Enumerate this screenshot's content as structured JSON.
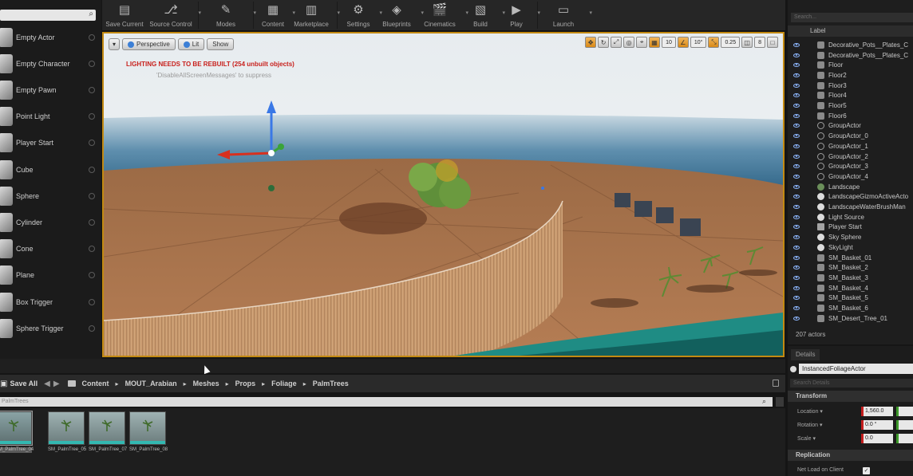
{
  "toolbar": {
    "buttons": [
      {
        "label": "Save Current",
        "icon": "save-icon"
      },
      {
        "label": "Source Control",
        "icon": "source-control-icon"
      },
      {
        "label": "Modes",
        "icon": "modes-icon"
      },
      {
        "label": "Content",
        "icon": "content-icon"
      },
      {
        "label": "Marketplace",
        "icon": "marketplace-icon"
      },
      {
        "label": "Settings",
        "icon": "settings-icon"
      },
      {
        "label": "Blueprints",
        "icon": "blueprints-icon"
      },
      {
        "label": "Cinematics",
        "icon": "cinematics-icon"
      },
      {
        "label": "Build",
        "icon": "build-icon"
      },
      {
        "label": "Play",
        "icon": "play-icon"
      },
      {
        "label": "Launch",
        "icon": "launch-icon"
      }
    ]
  },
  "place_panel": {
    "items": [
      {
        "label": "Empty Actor"
      },
      {
        "label": "Empty Character"
      },
      {
        "label": "Empty Pawn"
      },
      {
        "label": "Point Light"
      },
      {
        "label": "Player Start"
      },
      {
        "label": "Cube"
      },
      {
        "label": "Sphere"
      },
      {
        "label": "Cylinder"
      },
      {
        "label": "Cone"
      },
      {
        "label": "Plane"
      },
      {
        "label": "Box Trigger"
      },
      {
        "label": "Sphere Trigger"
      }
    ]
  },
  "viewport": {
    "perspective_label": "Perspective",
    "lit_label": "Lit",
    "show_label": "Show",
    "warning": "LIGHTING NEEDS TO BE REBUILT (254 unbuilt objects)",
    "suppress_hint": "'DisableAllScreenMessages' to suppress",
    "grid_snap": "10",
    "rotation_snap": "10°",
    "scale_snap": "0.25",
    "camera_speed": "8"
  },
  "outliner": {
    "search_placeholder": "Search...",
    "column_label": "Label",
    "rows": [
      {
        "label": "Decorative_Pots__Plates_C",
        "kind": "mesh"
      },
      {
        "label": "Decorative_Pots__Plates_C",
        "kind": "mesh"
      },
      {
        "label": "Floor",
        "kind": "mesh"
      },
      {
        "label": "Floor2",
        "kind": "mesh"
      },
      {
        "label": "Floor3",
        "kind": "mesh"
      },
      {
        "label": "Floor4",
        "kind": "mesh"
      },
      {
        "label": "Floor5",
        "kind": "mesh"
      },
      {
        "label": "Floor6",
        "kind": "mesh"
      },
      {
        "label": "GroupActor",
        "kind": "group"
      },
      {
        "label": "GroupActor_0",
        "kind": "group"
      },
      {
        "label": "GroupActor_1",
        "kind": "group"
      },
      {
        "label": "GroupActor_2",
        "kind": "group"
      },
      {
        "label": "GroupActor_3",
        "kind": "group"
      },
      {
        "label": "GroupActor_4",
        "kind": "group"
      },
      {
        "label": "Landscape",
        "kind": "land"
      },
      {
        "label": "LandscapeGizmoActiveActo",
        "kind": "light"
      },
      {
        "label": "LandscapeWaterBrushMan",
        "kind": "light"
      },
      {
        "label": "Light Source",
        "kind": "light"
      },
      {
        "label": "Player Start",
        "kind": "player"
      },
      {
        "label": "Sky Sphere",
        "kind": "light"
      },
      {
        "label": "SkyLight",
        "kind": "light"
      },
      {
        "label": "SM_Basket_01",
        "kind": "mesh"
      },
      {
        "label": "SM_Basket_2",
        "kind": "mesh"
      },
      {
        "label": "SM_Basket_3",
        "kind": "mesh"
      },
      {
        "label": "SM_Basket_4",
        "kind": "mesh"
      },
      {
        "label": "SM_Basket_5",
        "kind": "mesh"
      },
      {
        "label": "SM_Basket_6",
        "kind": "mesh"
      },
      {
        "label": "SM_Desert_Tree_01",
        "kind": "mesh"
      }
    ],
    "actor_count": "207 actors"
  },
  "details": {
    "tab_label": "Details",
    "selected_actor": "InstancedFoliageActor",
    "search_placeholder": "Search Details",
    "transform_section": "Transform",
    "location_label": "Location ▾",
    "location_x": "1,560.0",
    "rotation_label": "Rotation ▾",
    "rotation_x": "0.0 °",
    "scale_label": "Scale ▾",
    "scale_x": "0.0",
    "replication_section": "Replication",
    "net_load_label": "Net Load on Client"
  },
  "content_browser": {
    "save_all_label": "Save All",
    "breadcrumbs": [
      "Content",
      "MOUT_Arabian",
      "Meshes",
      "Props",
      "Foliage",
      "PalmTrees"
    ],
    "filter_text": "PalmTrees",
    "assets": [
      {
        "name": "SM_PalmTree_04",
        "selected": true
      },
      {
        "name": "SM_PalmTree_05",
        "selected": false
      },
      {
        "name": "SM_PalmTree_07",
        "selected": false
      },
      {
        "name": "SM_PalmTree_08",
        "selected": false
      }
    ]
  },
  "colors": {
    "viewport_border": "#c38a12",
    "warning_red": "#c8201c",
    "asset_underline": "#33b8b1"
  }
}
